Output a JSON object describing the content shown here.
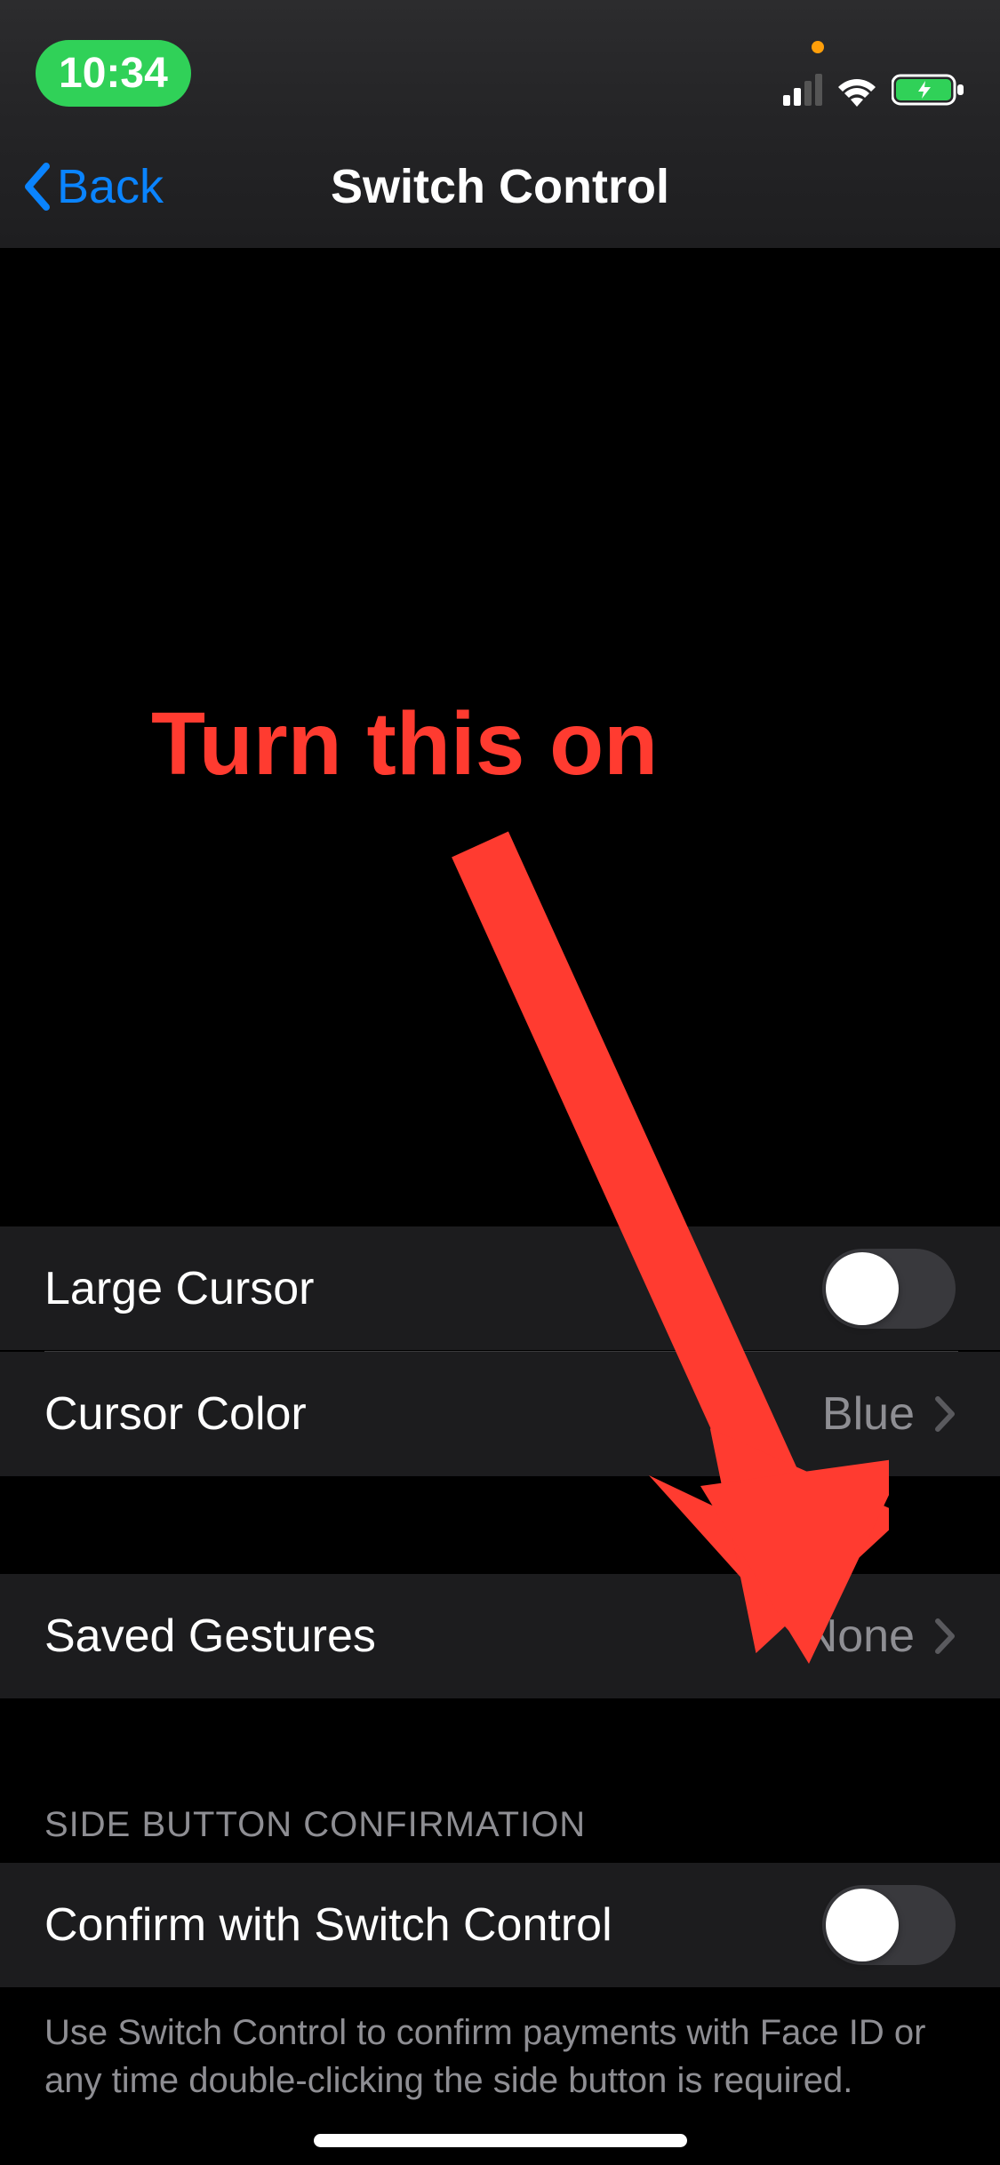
{
  "status": {
    "time": "10:34"
  },
  "nav": {
    "back": "Back",
    "title": "Switch Control"
  },
  "annotation": {
    "text": "Turn this on"
  },
  "rows": {
    "large_cursor": {
      "label": "Large Cursor",
      "on": false
    },
    "cursor_color": {
      "label": "Cursor Color",
      "value": "Blue"
    },
    "saved_gestures": {
      "label": "Saved Gestures",
      "value": "None"
    },
    "confirm": {
      "header": "SIDE BUTTON CONFIRMATION",
      "label": "Confirm with Switch Control",
      "on": false,
      "footer": "Use Switch Control to confirm payments with Face ID or any time double-clicking the side button is required."
    }
  }
}
